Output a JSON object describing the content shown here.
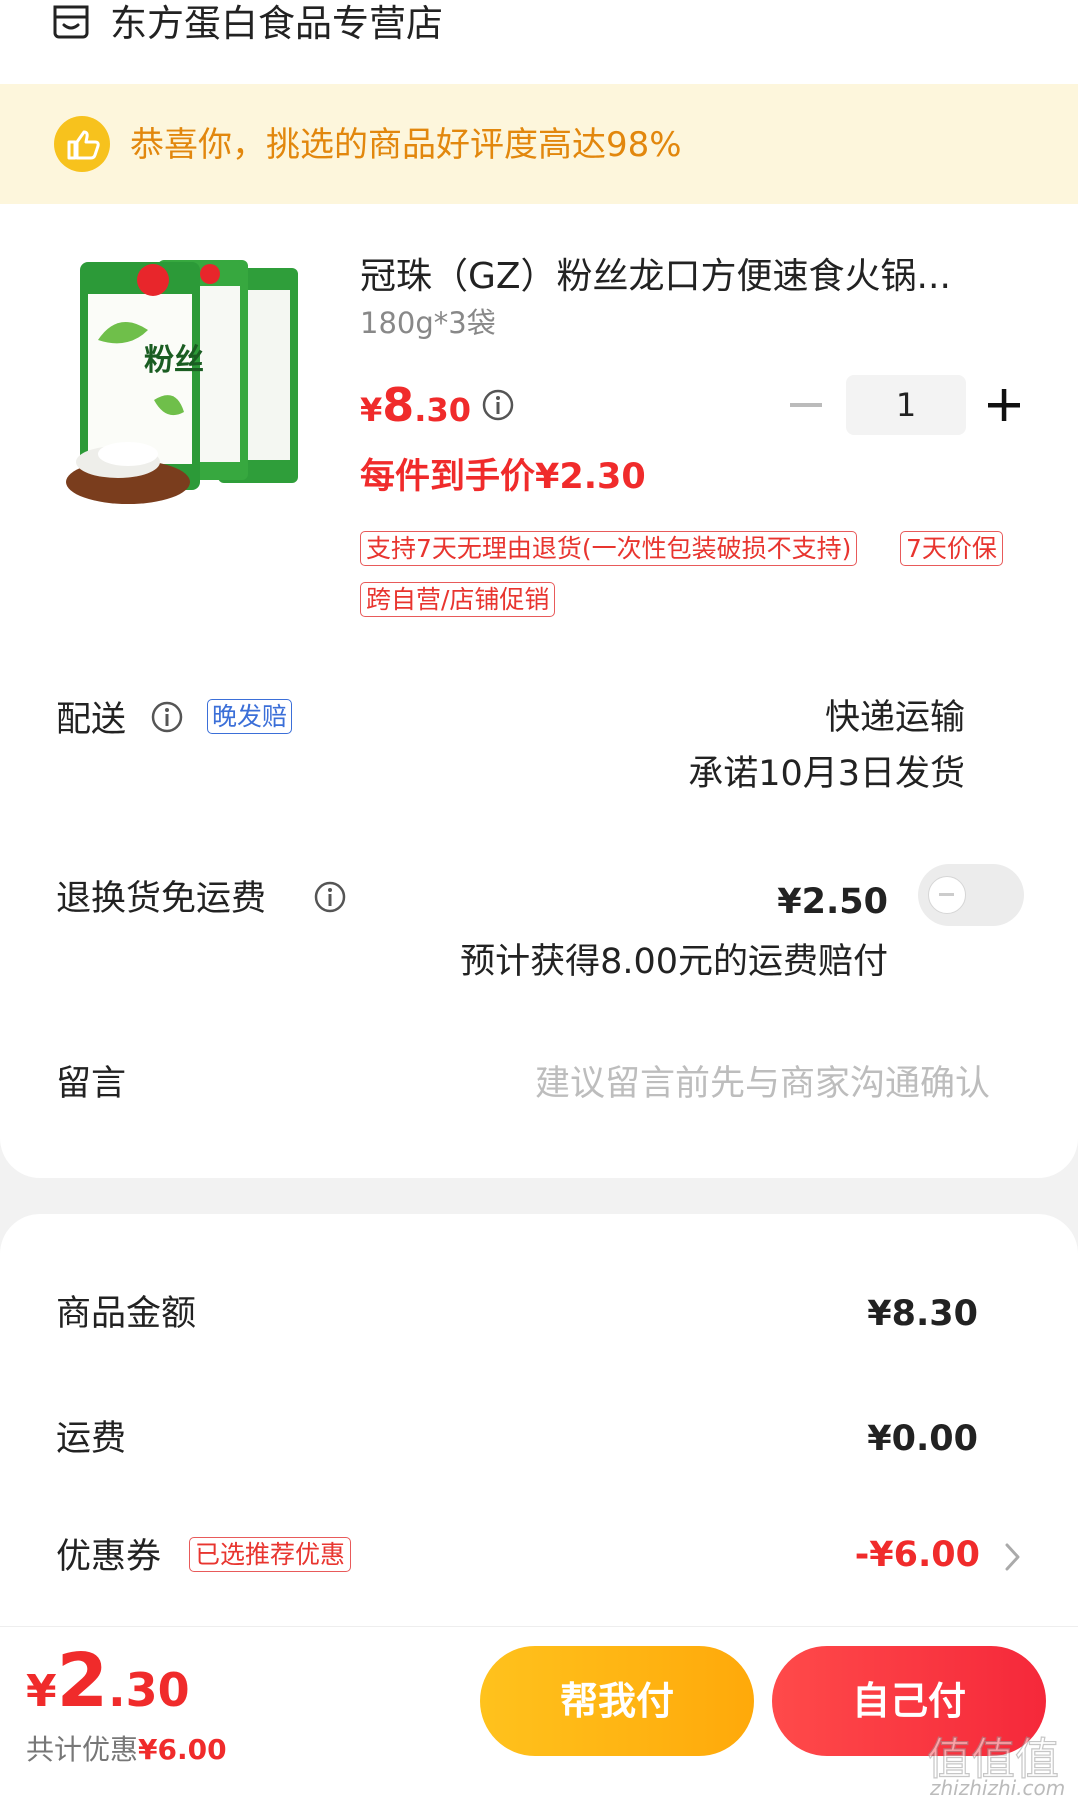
{
  "store": {
    "name": "东方蛋白食品专营店",
    "icon": "store-icon"
  },
  "banner": {
    "text": "恭喜你，挑选的商品好评度高达98%",
    "icon": "thumbs-up-icon"
  },
  "product": {
    "title": "冠珠（GZ）粉丝龙口方便速食火锅...",
    "spec": "180g*3袋",
    "price_currency": "¥",
    "price_int": "8",
    "price_dec": ".30",
    "net_price": "每件到手价¥2.30",
    "quantity": "1",
    "tags": [
      "支持7天无理由退货(一次性包装破损不支持)",
      "7天价保",
      "跨自营/店铺促销"
    ],
    "image_text": "粉丝"
  },
  "shipping": {
    "label": "配送",
    "badge": "晚发赔",
    "method": "快递运输",
    "promise": "承诺10月3日发货"
  },
  "return_freight": {
    "label": "退换货免运费",
    "price": "¥2.50",
    "note": "预计获得8.00元的运费赔付",
    "enabled": false
  },
  "message": {
    "label": "留言",
    "placeholder": "建议留言前先与商家沟通确认"
  },
  "summary": {
    "goods_label": "商品金额",
    "goods_value": "¥8.30",
    "freight_label": "运费",
    "freight_value": "¥0.00",
    "coupon_label": "优惠券",
    "coupon_tag": "已选推荐优惠",
    "coupon_value": "-¥6.00"
  },
  "footer": {
    "total_currency": "¥",
    "total_int": "2",
    "total_dec": ".30",
    "saving_label": "共计优惠",
    "saving_value": "¥6.00",
    "help_pay": "帮我付",
    "self_pay": "自己付"
  },
  "watermark": {
    "text": "zhizhizhi.com",
    "glyphs": "值值值"
  },
  "colors": {
    "price_red": "#f02b2b",
    "banner_bg": "#fdf6dc",
    "banner_text": "#e2870d",
    "help_btn": "#ffb515",
    "self_btn": "#f5303c",
    "badge_blue": "#3b6fd8"
  }
}
